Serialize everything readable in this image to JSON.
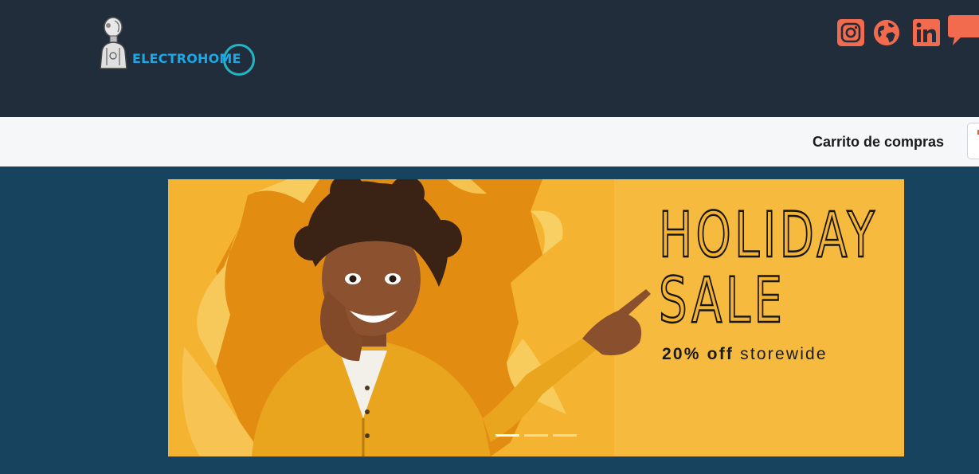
{
  "header": {
    "logo_text": "ELECTROHOME",
    "social": [
      {
        "name": "instagram-icon",
        "color": "#f26b4e"
      },
      {
        "name": "globe-icon",
        "color": "#f26b4e"
      },
      {
        "name": "linkedin-icon",
        "color": "#f26b4e"
      },
      {
        "name": "chat-bubble-icon",
        "color": "#f26b4e"
      }
    ]
  },
  "navbar": {
    "cart_label": "Carrito de compras"
  },
  "carousel": {
    "headline_line1": "HOLIDAY",
    "headline_line2": "SALE",
    "offer_bold": "20% off",
    "offer_text": "storewide",
    "slide_count": 3,
    "active_slide": 1
  },
  "colors": {
    "header_bg": "#222d3b",
    "navbar_bg": "#f6f7f9",
    "page_bg": "#17435f",
    "banner_bg": "#f4b431",
    "accent": "#f26b4e",
    "logo_blue": "#1aa8e8"
  }
}
